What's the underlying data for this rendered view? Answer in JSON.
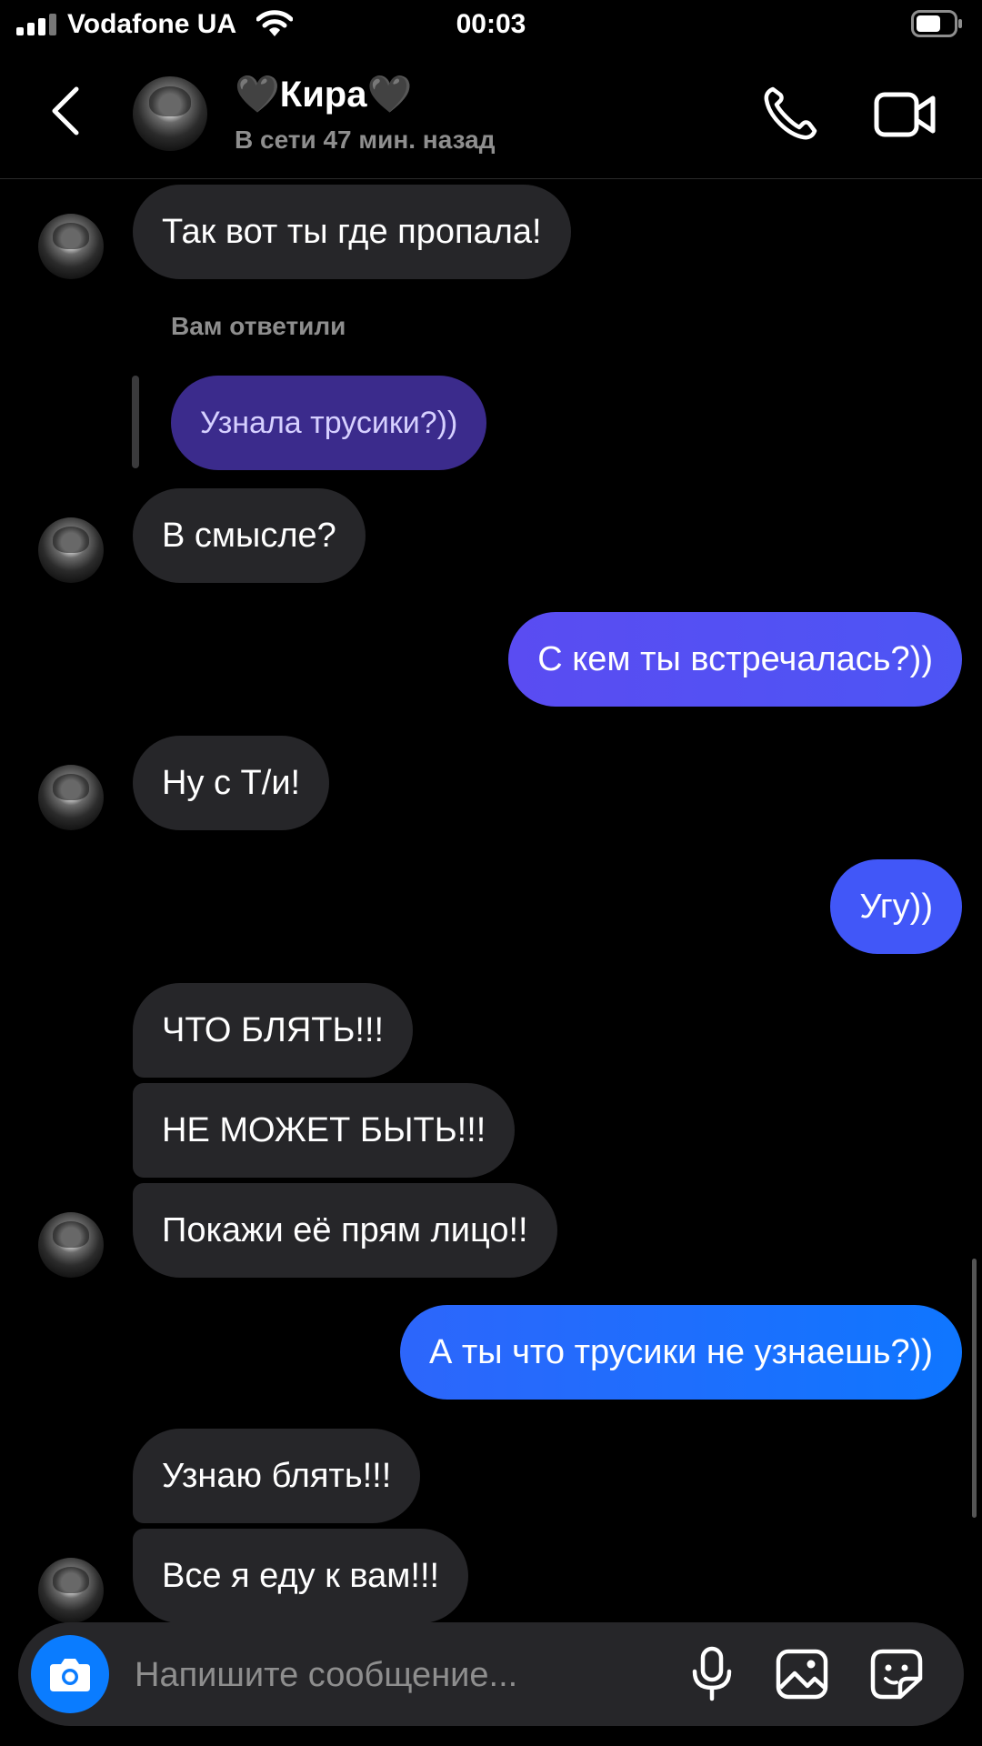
{
  "status_bar": {
    "carrier": "Vodafone UA",
    "time": "00:03",
    "icons": [
      "signal-icon",
      "wifi-icon",
      "battery-icon"
    ]
  },
  "header": {
    "contact_name": "🖤Кира🖤",
    "contact_status": "В сети 47 мин. назад",
    "icons": [
      "back-arrow-icon",
      "phone-icon",
      "video-camera-icon"
    ]
  },
  "conversation": {
    "reply_label": "Вам ответили",
    "replied_to_text": "Узнала трусики?))",
    "messages": [
      {
        "sender": "contact",
        "text": "Так вот ты где пропала!"
      },
      {
        "sender": "contact",
        "text": "В смысле?"
      },
      {
        "sender": "me",
        "text": "С кем ты встречалась?))"
      },
      {
        "sender": "contact",
        "text": "Ну с Т/и!"
      },
      {
        "sender": "me",
        "text": "Угу))"
      },
      {
        "sender": "contact",
        "text": "ЧТО БЛЯТЬ!!!"
      },
      {
        "sender": "contact",
        "text": "НЕ МОЖЕТ БЫТЬ!!!"
      },
      {
        "sender": "contact",
        "text": "Покажи её прям лицо!!"
      },
      {
        "sender": "me",
        "text": "А ты что трусики не узнаешь?))"
      },
      {
        "sender": "contact",
        "text": "Узнаю блять!!!"
      },
      {
        "sender": "contact",
        "text": "Все я еду к вам!!!"
      }
    ]
  },
  "composer": {
    "placeholder": "Напишите сообщение...",
    "icons": [
      "camera-icon",
      "microphone-icon",
      "gallery-icon",
      "sticker-icon"
    ]
  },
  "colors": {
    "background": "#000000",
    "incoming_bubble": "#262629",
    "outgoing_gradient": [
      "#5b4bf2",
      "#0a7cff"
    ],
    "reply_bubble": "#3b2b8c",
    "camera_button": "#0a7cff",
    "secondary_text": "#8e8e8e"
  }
}
